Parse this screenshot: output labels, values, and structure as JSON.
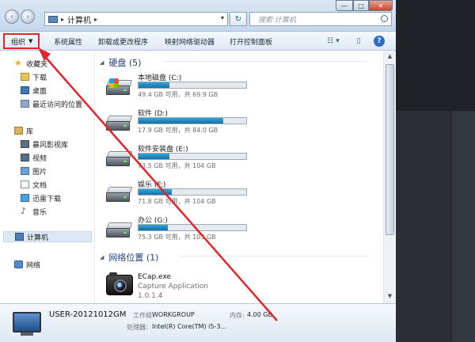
{
  "window": {
    "controls": {
      "minimize": "—",
      "maximize": "□",
      "close": "✕"
    }
  },
  "address": {
    "back": "‹",
    "forward": "›",
    "separator": "▸",
    "path": "计算机",
    "separator_after": "▸",
    "dropdown": "▾",
    "refresh": "↻",
    "search_placeholder": "搜索 计算机"
  },
  "toolbar": {
    "organize": "组织",
    "organize_arrow": "▼",
    "items": [
      "系统属性",
      "卸载或更改程序",
      "映射网络驱动器",
      "打开控制面板"
    ],
    "view_icon": "☷ ▾",
    "pane_icon": "▯",
    "help": "?"
  },
  "nav": {
    "favorites": "收藏夹",
    "downloads": "下载",
    "desktop": "桌面",
    "recent": "最近访问的位置",
    "libraries": "库",
    "storm_video": "暴风影视库",
    "videos": "视频",
    "pictures": "图片",
    "documents": "文档",
    "thunder": "迅雷下载",
    "music": "音乐",
    "computer": "计算机",
    "network": "网络"
  },
  "main": {
    "disks_header": "硬盘 (5)",
    "network_header": "网络位置 (1)",
    "drives": [
      {
        "name": "本地磁盘 (C:)",
        "info": "49.4 GB 可用，共 69.9 GB",
        "used": 0.29,
        "system": true
      },
      {
        "name": "软件 (D:)",
        "info": "17.9 GB 可用，共 84.0 GB",
        "used": 0.79,
        "system": false
      },
      {
        "name": "软件安装盘 (E:)",
        "info": "73.5 GB 可用，共 104 GB",
        "used": 0.29,
        "system": false
      },
      {
        "name": "娱乐 (F:)",
        "info": "71.8 GB 可用，共 104 GB",
        "used": 0.31,
        "system": false
      },
      {
        "name": "办公 (G:)",
        "info": "75.3 GB 可用，共 103 GB",
        "used": 0.27,
        "system": false
      }
    ],
    "app": {
      "name": "ECap.exe",
      "desc": "Capture Application",
      "version": "1.0.1.4"
    }
  },
  "details": {
    "pc_name": "USER-20121012GM",
    "workgroup_label": "工作组:",
    "workgroup": "WORKGROUP",
    "memory_label": "内存:",
    "memory": "4.00 GB",
    "cpu_label": "处理器:",
    "cpu": "Intel(R) Core(TM) i5-3..."
  },
  "colors": {
    "annotation": "#e0262d",
    "bar_fill": "#1a8cc4",
    "header_text": "#1e3f79"
  }
}
